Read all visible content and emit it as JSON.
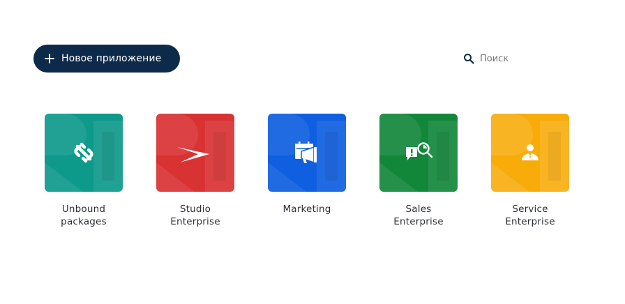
{
  "header": {
    "new_app_label": "Новое приложение",
    "search_placeholder": "Поиск"
  },
  "apps": [
    {
      "line1": "Unbound",
      "line2": "packages",
      "color": "#0e9a8a",
      "icon": "unlink-icon"
    },
    {
      "line1": "Studio",
      "line2": "Enterprise",
      "color": "#d93233",
      "icon": "studio-swoosh-icon"
    },
    {
      "line1": "Marketing",
      "line2": "",
      "color": "#0f5fe0",
      "icon": "calendar-megaphone-icon"
    },
    {
      "line1": "Sales",
      "line2": "Enterprise",
      "color": "#12873a",
      "icon": "sales-search-icon"
    },
    {
      "line1": "Service",
      "line2": "Enterprise",
      "color": "#f8ac0a",
      "icon": "service-agent-icon"
    }
  ],
  "colors": {
    "button_bg": "#0d2a4a",
    "text": "#2b2f36",
    "search_icon": "#0d2a4a"
  }
}
